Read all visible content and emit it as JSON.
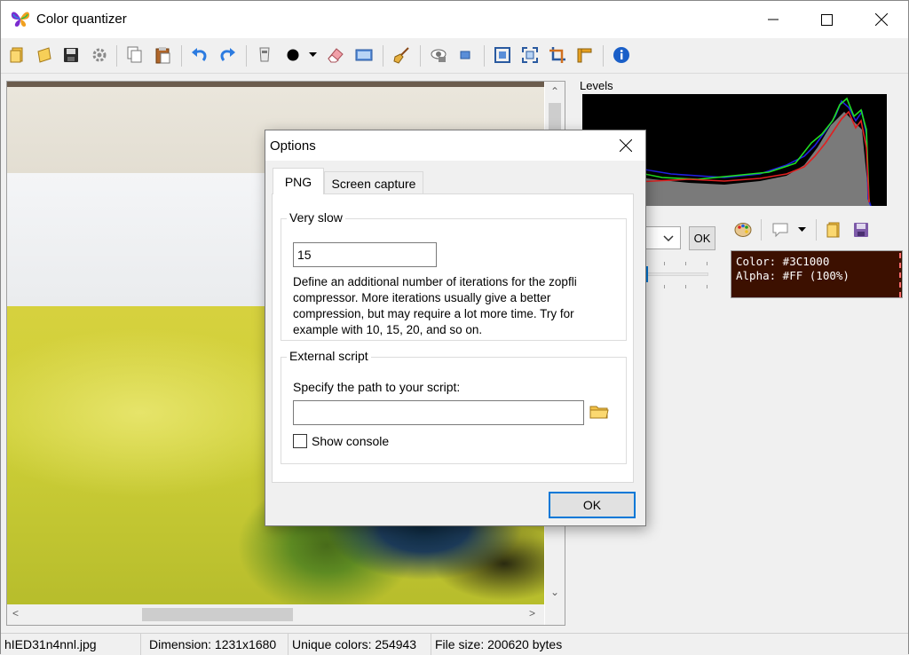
{
  "window": {
    "title": "Color quantizer",
    "controls": {
      "minimize": "minimize-icon",
      "maximize": "maximize-icon",
      "close": "close-icon"
    }
  },
  "toolbar": {
    "icons": [
      "open-icon",
      "open-recent-icon",
      "save-icon",
      "settings-gear-icon",
      "copy-icon",
      "paste-icon",
      "undo-icon",
      "redo-icon",
      "pipette-icon",
      "brush-size-dot-icon",
      "dropdown-arrow-icon",
      "eraser-icon",
      "screen-icon",
      "broom-icon",
      "eye-icon",
      "small-image-icon",
      "fit-icon",
      "fullscreen-icon",
      "crop-icon",
      "resize-icon",
      "info-icon"
    ]
  },
  "right_panel": {
    "levels_label": "Levels",
    "ok_label": "OK",
    "color_info": {
      "color_line": "Color: #3C1000",
      "alpha_line": "Alpha: #FF (100%)",
      "swatch": "#3C1000"
    },
    "palette_icons": [
      "palette-icon",
      "speech-bubble-icon",
      "dropdown-arrow-icon",
      "folder-icon",
      "save-icon"
    ]
  },
  "status_bar": {
    "filename": "hIED31n4nnl.jpg",
    "dimension": "Dimension: 1231x1680",
    "unique_colors": "Unique colors: 254943",
    "file_size": "File size: 200620 bytes"
  },
  "dialog": {
    "title": "Options",
    "tabs": [
      {
        "label": "PNG",
        "active": true
      },
      {
        "label": "Screen capture",
        "active": false
      }
    ],
    "very_slow": {
      "group_label": "Very slow",
      "value": "15",
      "description_lines": [
        "Define an additional number of iterations for the zopfli",
        "compressor. More iterations usually give a better",
        "compression, but may require a lot more time. Try for",
        "example with 10, 15, 20, and so on."
      ]
    },
    "external_script": {
      "group_label": "External script",
      "path_label": "Specify the path to your script:",
      "path_value": "",
      "show_console_label": "Show console",
      "show_console_checked": false
    },
    "ok_label": "OK"
  },
  "colors": {
    "accent": "#0078D7",
    "histogram_background": "#000000",
    "histogram_red": "#E02020",
    "histogram_green": "#20E020",
    "histogram_blue": "#2020E0",
    "histogram_gray": "#808080"
  }
}
